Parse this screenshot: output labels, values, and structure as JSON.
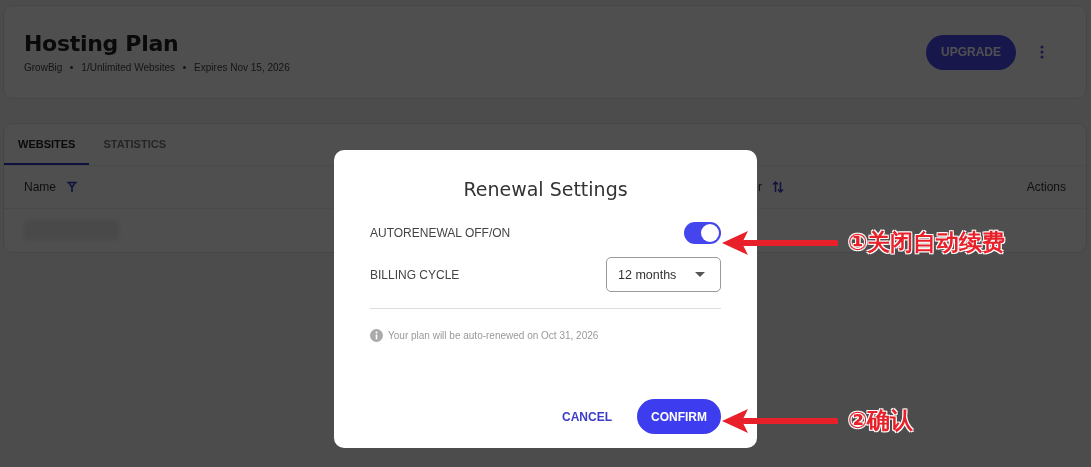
{
  "plan": {
    "title": "Hosting Plan",
    "meta": [
      "GrowBig",
      "1/Unlimited Websites",
      "Expires Nov 15, 2026"
    ],
    "upgrade_button": "UPGRADE"
  },
  "tabs": [
    {
      "label": "WEBSITES",
      "selected": true
    },
    {
      "label": "STATISTICS",
      "selected": false
    }
  ],
  "table": {
    "columns": [
      {
        "label": "Name",
        "kind": "filterable"
      },
      {
        "label": "r",
        "kind": "sortable"
      },
      {
        "label": "Actions"
      }
    ],
    "rows": [
      {
        "kind": "redacted"
      }
    ]
  },
  "dialog": {
    "title": "Renewal Settings",
    "autorenewal": {
      "label": "AUTORENEWAL OFF/ON",
      "on": true
    },
    "billing_cycle": {
      "label": "BILLING CYCLE",
      "value": "12 months"
    },
    "note": "Your plan will be auto-renewed on Oct 31, 2026",
    "buttons": [
      {
        "label": "CANCEL",
        "kind": "text"
      },
      {
        "label": "CONFIRM",
        "kind": "primary"
      }
    ]
  },
  "annotations": [
    {
      "text": "①关闭自动续费"
    },
    {
      "text": "②确认"
    }
  ]
}
